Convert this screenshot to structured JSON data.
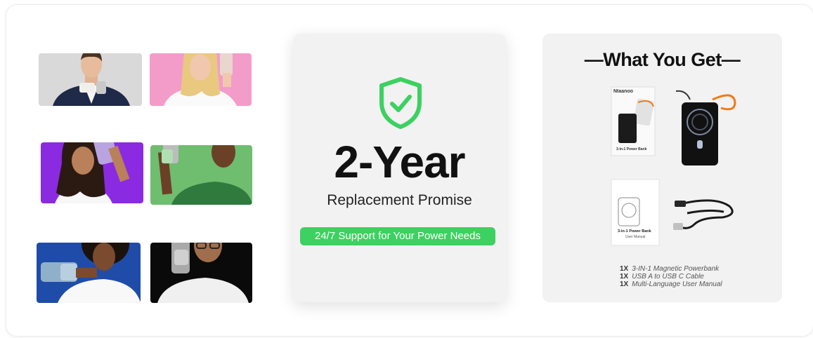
{
  "center": {
    "icon": "shield-check-icon",
    "headline": "2-Year",
    "subheadline": "Replacement Promise",
    "support_badge": "24/7 Support for Your Power Needs",
    "accent_color": "#3cd160"
  },
  "contents": {
    "title": "—What You Get—",
    "box_brand": "Ntaanoo",
    "box_label": "3-in-1 Power Bank",
    "manual_label": "3-in-1 Power Bank",
    "manual_sublabel": "User Manual",
    "items": [
      {
        "qty": "1X",
        "label": "3-IN-1 Magnetic Powerbank"
      },
      {
        "qty": "1X",
        "label": "USB A to USB C Cable"
      },
      {
        "qty": "1X",
        "label": "Multi-Language User Manual"
      }
    ]
  },
  "photos": [
    {
      "name": "man-navy-blazer-photo",
      "background": "#d9d9d9"
    },
    {
      "name": "woman-blonde-pink-photo",
      "background": "#f39cc9"
    },
    {
      "name": "woman-curly-purple-photo",
      "background": "#8a2be2"
    },
    {
      "name": "man-green-sweater-photo",
      "background": "#6fbd6f"
    },
    {
      "name": "woman-afro-blue-photo",
      "background": "#1f4ca8"
    },
    {
      "name": "man-glasses-black-photo",
      "background": "#0a0a0a"
    }
  ]
}
